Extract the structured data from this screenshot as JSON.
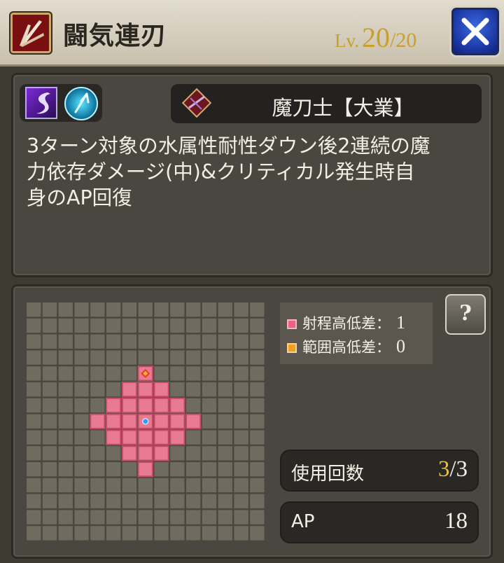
{
  "header": {
    "skill_icon": "crossed-blades-icon",
    "title": "闘気連刃",
    "level_prefix": "Lv.",
    "level_current": "20",
    "level_max": "/20",
    "close_icon": "close-icon"
  },
  "info": {
    "attribute_icons": [
      "dark-attribute-icon",
      "water-attribute-icon"
    ],
    "job_icon": "sword-job-icon",
    "job_name": "魔刀士【大業】",
    "description": [
      "3ターン対象の水属性耐性ダウン後2連続の魔",
      "力依存ダメージ(中)&クリティカル発生時自",
      "身のAP回復"
    ]
  },
  "range": {
    "grid_size": 15,
    "caster_cell": [
      7,
      7
    ],
    "target_cell": [
      7,
      4
    ],
    "range_cells": [
      [
        7,
        4
      ],
      [
        6,
        5
      ],
      [
        7,
        5
      ],
      [
        8,
        5
      ],
      [
        5,
        6
      ],
      [
        6,
        6
      ],
      [
        7,
        6
      ],
      [
        8,
        6
      ],
      [
        9,
        6
      ],
      [
        4,
        7
      ],
      [
        5,
        7
      ],
      [
        6,
        7
      ],
      [
        7,
        7
      ],
      [
        8,
        7
      ],
      [
        9,
        7
      ],
      [
        10,
        7
      ],
      [
        5,
        8
      ],
      [
        6,
        8
      ],
      [
        7,
        8
      ],
      [
        8,
        8
      ],
      [
        9,
        8
      ],
      [
        6,
        9
      ],
      [
        7,
        9
      ],
      [
        8,
        9
      ],
      [
        7,
        10
      ]
    ],
    "legend": [
      {
        "label": "射程高低差：",
        "value": "1",
        "color": "#e8647f"
      },
      {
        "label": "範囲高低差：",
        "value": "0",
        "color": "#f0a023"
      }
    ],
    "help_label": "?"
  },
  "stats": {
    "uses_label": "使用回数",
    "uses_current": "3",
    "uses_max": "/3",
    "ap_label": "AP",
    "ap_value": "18"
  },
  "colors": {
    "cell_empty": "#6f6b5e",
    "cell_range": "#e87b91",
    "cell_range_border": "#c34a65",
    "caster_dot": "#2e9bff",
    "target_diamond": "#e53c21",
    "gold": "#e8c23a"
  }
}
